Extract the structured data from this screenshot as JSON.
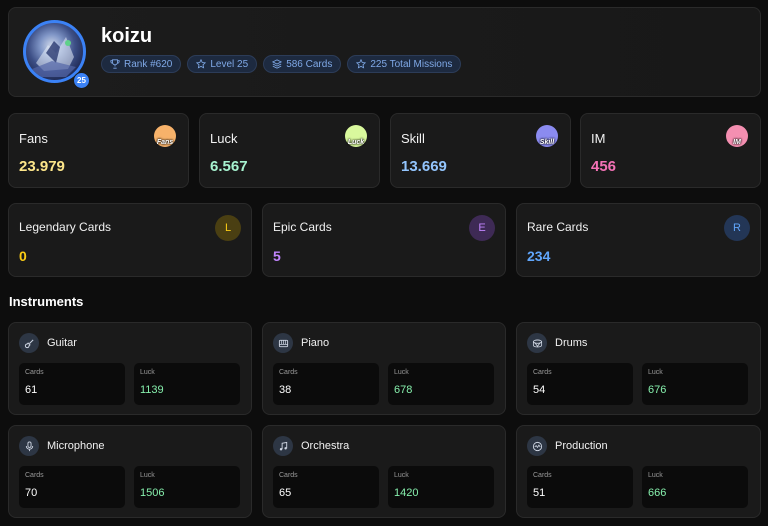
{
  "profile": {
    "username": "koizu",
    "level_badge": "25",
    "badges": [
      {
        "icon": "trophy-icon",
        "label": "Rank #620"
      },
      {
        "icon": "star-icon",
        "label": "Level 25"
      },
      {
        "icon": "layers-icon",
        "label": "586 Cards"
      },
      {
        "icon": "star-icon",
        "label": "225 Total Missions"
      }
    ]
  },
  "stats": [
    {
      "title": "Fans",
      "value": "23.979",
      "color": "#fde68a",
      "icon_label": "Fans",
      "icon_bg": "#f7b26a"
    },
    {
      "title": "Luck",
      "value": "6.567",
      "color": "#a7f3d0",
      "icon_label": "Luck",
      "icon_bg": "#d9f99d"
    },
    {
      "title": "Skill",
      "value": "13.669",
      "color": "#93c5fd",
      "icon_label": "Skill",
      "icon_bg": "#8b8bf0"
    },
    {
      "title": "IM",
      "value": "456",
      "color": "#f472b6",
      "icon_label": "IM",
      "icon_bg": "#f48fb1"
    }
  ],
  "rarities": [
    {
      "title": "Legendary Cards",
      "value": "0",
      "letter": "L",
      "color": "#facc15",
      "bg": "#4a3f12"
    },
    {
      "title": "Epic Cards",
      "value": "5",
      "letter": "E",
      "color": "#c084fc",
      "bg": "#3e2a55"
    },
    {
      "title": "Rare Cards",
      "value": "234",
      "letter": "R",
      "color": "#60a5fa",
      "bg": "#233656"
    }
  ],
  "instruments_title": "Instruments",
  "instruments": [
    {
      "name": "Guitar",
      "icon": "guitar-icon",
      "cards_label": "Cards",
      "cards": "61",
      "luck_label": "Luck",
      "luck": "1139"
    },
    {
      "name": "Piano",
      "icon": "piano-icon",
      "cards_label": "Cards",
      "cards": "38",
      "luck_label": "Luck",
      "luck": "678"
    },
    {
      "name": "Drums",
      "icon": "drums-icon",
      "cards_label": "Cards",
      "cards": "54",
      "luck_label": "Luck",
      "luck": "676"
    },
    {
      "name": "Microphone",
      "icon": "microphone-icon",
      "cards_label": "Cards",
      "cards": "70",
      "luck_label": "Luck",
      "luck": "1506"
    },
    {
      "name": "Orchestra",
      "icon": "music-note-icon",
      "cards_label": "Cards",
      "cards": "65",
      "luck_label": "Luck",
      "luck": "1420"
    },
    {
      "name": "Production",
      "icon": "production-icon",
      "cards_label": "Cards",
      "cards": "51",
      "luck_label": "Luck",
      "luck": "666"
    }
  ],
  "colors": {
    "accent": "#3b82f6",
    "luck_value": "#86efac"
  }
}
